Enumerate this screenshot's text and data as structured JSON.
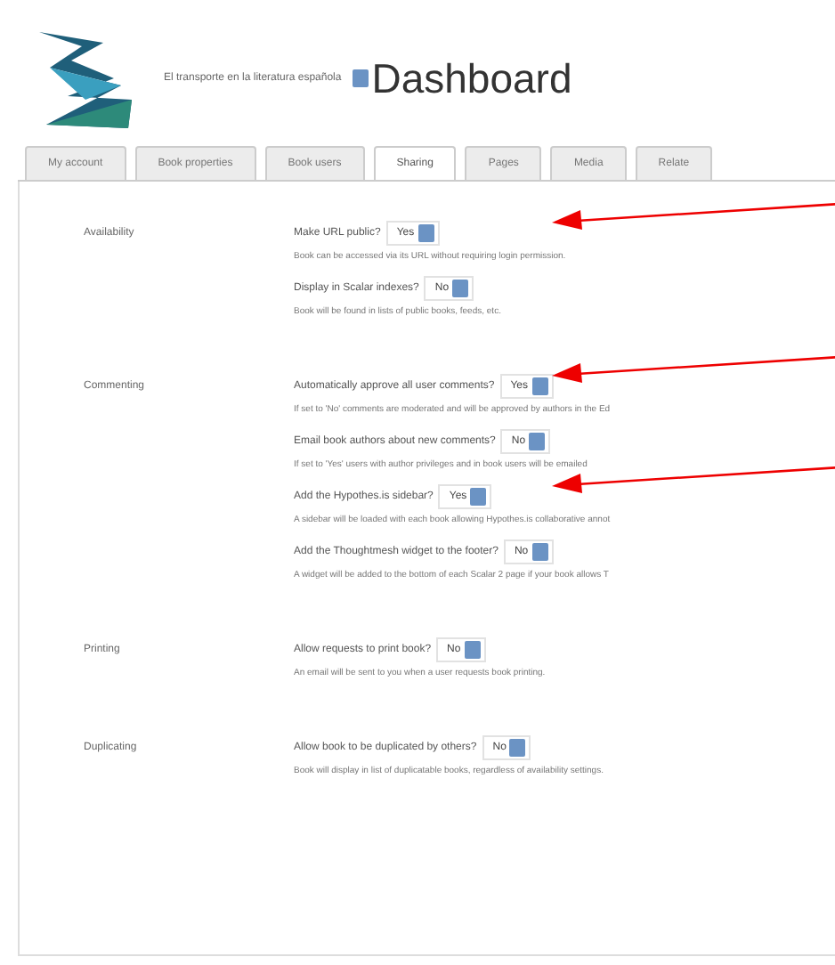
{
  "header": {
    "book_title": "El transporte en la literatura española",
    "heading": "Dashboard"
  },
  "tabs": [
    {
      "label": "My account",
      "selected": false
    },
    {
      "label": "Book properties",
      "selected": false
    },
    {
      "label": "Book users",
      "selected": false
    },
    {
      "label": "Sharing",
      "selected": true
    },
    {
      "label": "Pages",
      "selected": false
    },
    {
      "label": "Media",
      "selected": false
    },
    {
      "label": "Relate",
      "selected": false
    }
  ],
  "sections": [
    {
      "label": "Availability",
      "settings": [
        {
          "question": "Make URL public?",
          "value": "Yes",
          "arrow": true,
          "description": "Book can be accessed via its URL without requiring login permission."
        },
        {
          "question": "Display in Scalar indexes?",
          "value": "No",
          "arrow": false,
          "description": "Book will be found in lists of public books, feeds, etc."
        }
      ]
    },
    {
      "label": "Commenting",
      "settings": [
        {
          "question": "Automatically approve all user comments?",
          "value": "Yes",
          "arrow": true,
          "description": "If set to 'No' comments are moderated and will be approved by authors in the Ed"
        },
        {
          "question": "Email book authors about new comments?",
          "value": "No",
          "arrow": false,
          "description": "If set to 'Yes' users with author privileges and in book users will be emailed"
        },
        {
          "question": "Add the Hypothes.is sidebar?",
          "value": "Yes",
          "arrow": true,
          "description": "A sidebar will be loaded with each book allowing Hypothes.is collaborative annot"
        },
        {
          "question": "Add the Thoughtmesh widget to the footer?",
          "value": "No",
          "arrow": false,
          "description": "A widget will be added to the bottom of each Scalar 2 page if your book allows T"
        }
      ]
    },
    {
      "label": "Printing",
      "settings": [
        {
          "question": "Allow requests to print book?",
          "value": "No",
          "arrow": false,
          "description": "An email will be sent to you when a user requests book printing."
        }
      ]
    },
    {
      "label": "Duplicating",
      "settings": [
        {
          "question": "Allow book to be duplicated by others?",
          "value": "No",
          "arrow": false,
          "description": "Book will display in list of duplicatable books, regardless of availability settings."
        }
      ]
    }
  ]
}
